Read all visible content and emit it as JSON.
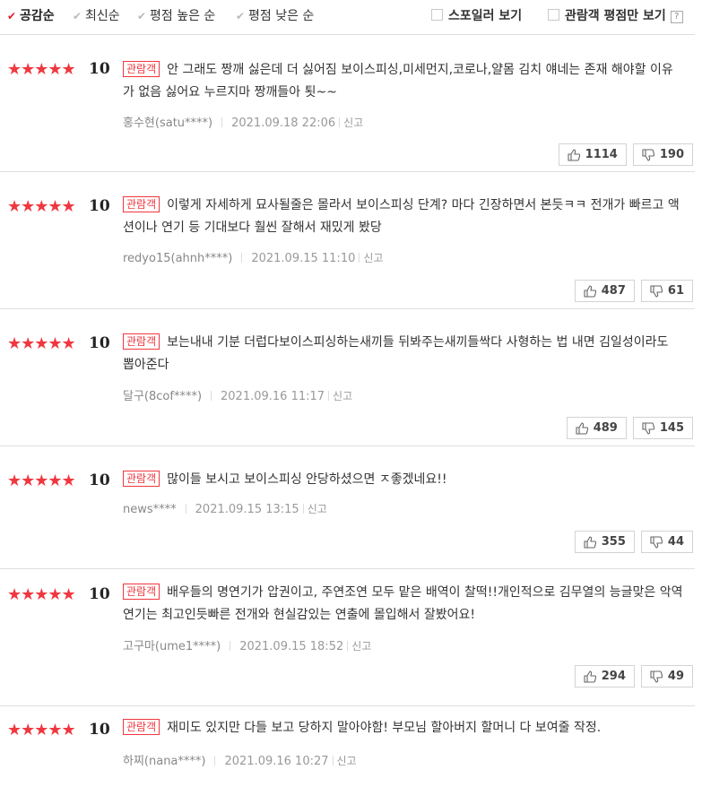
{
  "sort": {
    "options": [
      {
        "label": "공감순",
        "active": true
      },
      {
        "label": "최신순",
        "active": false
      },
      {
        "label": "평점 높은 순",
        "active": false
      },
      {
        "label": "평점 낮은 순",
        "active": false
      }
    ],
    "spoiler_label": "스포일러 보기",
    "audience_label": "관람객 평점만 보기",
    "help": "?"
  },
  "reviews": [
    {
      "stars": 5,
      "score": "10",
      "badge": "관람객",
      "text": "안 그래도 짱깨 싫은데 더 싫어짐 보이스피싱,미세먼지,코로나,얄몸 김치 얘네는 존재 해야할 이유가 없음 싫어요 누르지마 짱깨들아 툇~~",
      "user": "홍수현(satu****)",
      "date": "2021.09.18 22:06",
      "report": "신고",
      "likes": "1114",
      "dislikes": "190"
    },
    {
      "stars": 5,
      "score": "10",
      "badge": "관람객",
      "text": "이렇게 자세하게 묘사될줄은 몰라서 보이스피싱 단계? 마다 긴장하면서 본듯ㅋㅋ 전개가 빠르고 액션이나 연기 등 기대보다 훨씬 잘해서 재밌게 봤당",
      "user": "redyo15(ahnh****)",
      "date": "2021.09.15 11:10",
      "report": "신고",
      "likes": "487",
      "dislikes": "61"
    },
    {
      "stars": 5,
      "score": "10",
      "badge": "관람객",
      "text": "보는내내 기분 더럽다보이스피싱하는새끼들 뒤봐주는새끼들싹다 사형하는 법 내면 김일성이라도 뽑아준다",
      "user": "달구(8cof****)",
      "date": "2021.09.16 11:17",
      "report": "신고",
      "likes": "489",
      "dislikes": "145"
    },
    {
      "stars": 5,
      "score": "10",
      "badge": "관람객",
      "text": "많이들 보시고 보이스피싱 안당하셨으면 ㅈ좋겠네요!!",
      "user": "news****",
      "date": "2021.09.15 13:15",
      "report": "신고",
      "likes": "355",
      "dislikes": "44"
    },
    {
      "stars": 5,
      "score": "10",
      "badge": "관람객",
      "text": "배우들의 명연기가 압권이고, 주연조연 모두 맡은 배역이 찰떡!!개인적으로 김무열의 능글맞은 악역 연기는 최고인듯빠른 전개와 현실감있는 연출에 몰입해서 잘봤어요!",
      "user": "고구마(ume1****)",
      "date": "2021.09.15 18:52",
      "report": "신고",
      "likes": "294",
      "dislikes": "49"
    },
    {
      "stars": 5,
      "score": "10",
      "badge": "관람객",
      "text": "재미도 있지만 다들 보고 당하지 말아야함! 부모님 할아버지 할머니 다 보여줄 작정.",
      "user": "하찌(nana****)",
      "date": "2021.09.16 10:27",
      "report": "신고",
      "likes": "",
      "dislikes": ""
    }
  ],
  "colors": {
    "star": "#f0373f",
    "accent": "#e51e2e"
  }
}
